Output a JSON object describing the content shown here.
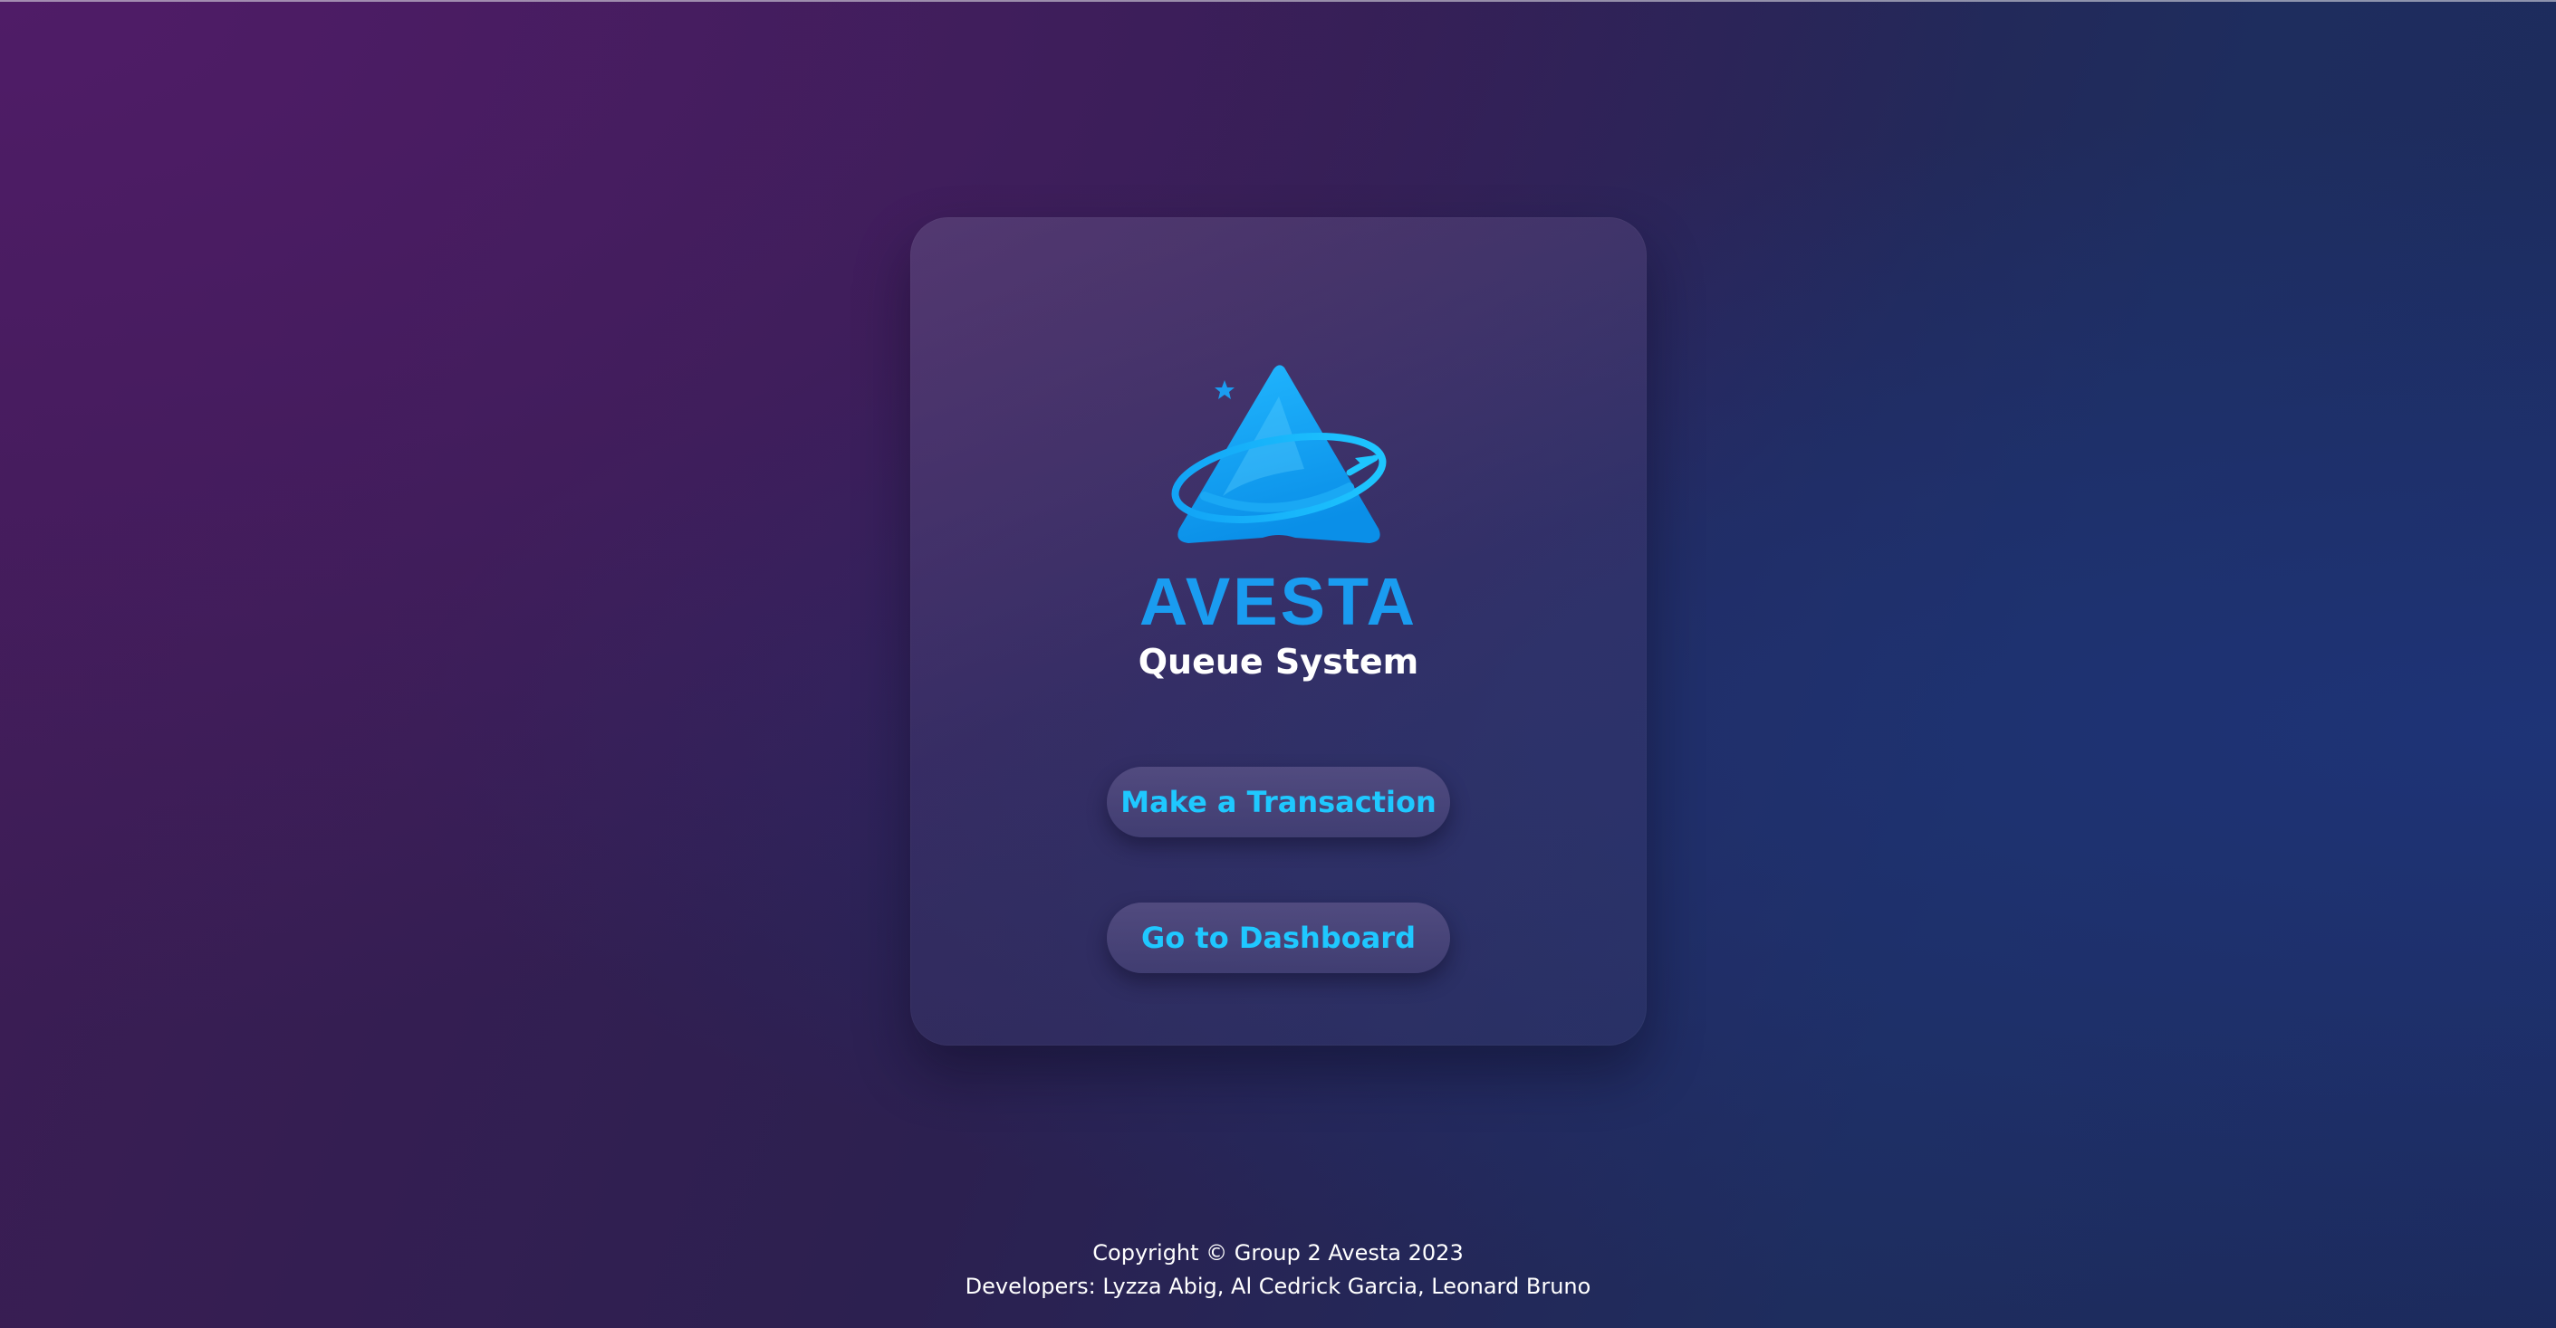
{
  "brand": {
    "logo_icon": "avesta-triangle-orbit-logo",
    "title": "AVESTA",
    "subtitle": "Queue System"
  },
  "actions": {
    "make_transaction_label": "Make a Transaction",
    "dashboard_label": "Go to Dashboard"
  },
  "footer": {
    "copyright": "Copyright © Group 2 Avesta 2023",
    "developers": "Developers: Lyzza Abig, Al Cedrick Garcia, Leonard Bruno"
  },
  "colors": {
    "brand_blue": "#1a9cf0",
    "button_text": "#1fc8ff",
    "background_left": "#3f1c55",
    "background_right": "#1c2a5c"
  }
}
